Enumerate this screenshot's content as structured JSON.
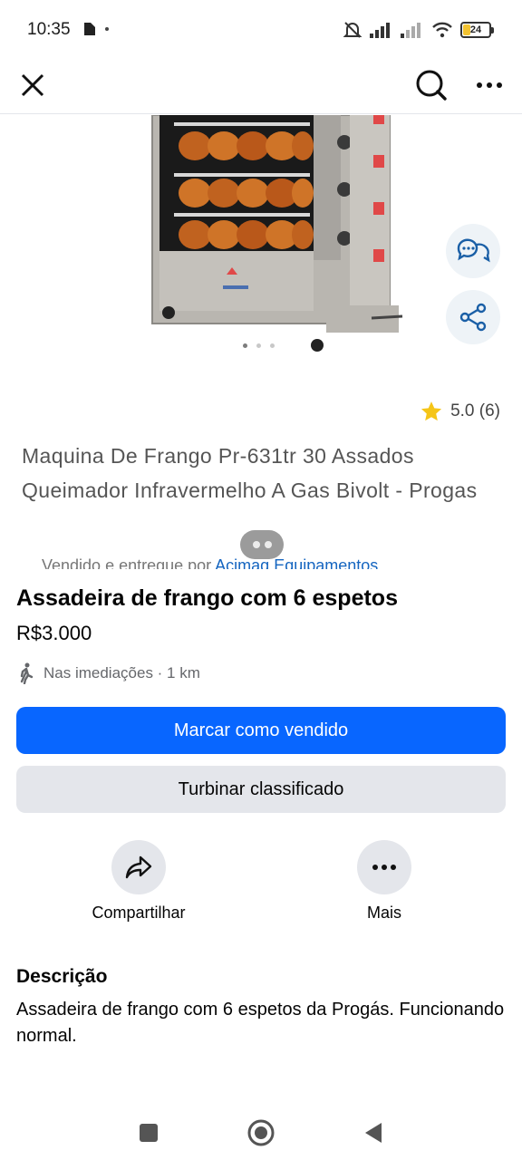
{
  "status_bar": {
    "time": "10:35",
    "battery": "24"
  },
  "toolbar": {
    "close_icon": "close-icon",
    "search_icon": "search-icon",
    "more_icon": "more-horizontal-icon"
  },
  "media": {
    "image_description_icon": "rotisserie-oven-photo",
    "dots_count": 3,
    "active_dot": 1
  },
  "embedded_listing": {
    "rating": "5.0 (6)",
    "title": "Maquina De Frango Pr-631tr 30 Assados Queimador Infravermelho A Gas Bivolt - Progas",
    "sold_by_prefix": "Vendido e entregue por",
    "sold_by_link": "Acimaq Equipamentos"
  },
  "listing": {
    "title": "Assadeira de frango com 6 espetos",
    "price": "R$3.000",
    "location": "Nas imediações · 1 km"
  },
  "buttons": {
    "mark_sold": "Marcar como vendido",
    "boost": "Turbinar classificado"
  },
  "actions": {
    "share": "Compartilhar",
    "more": "Mais"
  },
  "description": {
    "heading": "Descrição",
    "text": "Assadeira de frango com 6 espetos da Progás. Funcionando normal."
  },
  "colors": {
    "primary": "#0866ff",
    "secondary_bg": "#e4e6eb",
    "star": "#f5c518"
  }
}
